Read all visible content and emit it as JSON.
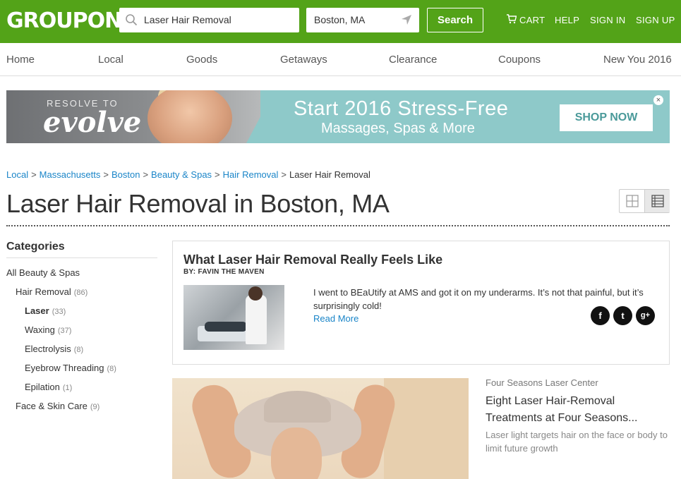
{
  "header": {
    "logo": "GROUPON",
    "search_value": "Laser Hair Removal",
    "location_value": "Boston, MA",
    "search_button": "Search",
    "cart": "CART",
    "help": "HELP",
    "sign_in": "SIGN IN",
    "sign_up": "SIGN UP",
    "brand_color": "#53a318"
  },
  "topnav": [
    "Home",
    "Local",
    "Goods",
    "Getaways",
    "Clearance",
    "Coupons",
    "New You 2016"
  ],
  "banner": {
    "resolve_to": "RESOLVE TO",
    "evolve": "evolve",
    "headline": "Start 2016 Stress-Free",
    "subline": "Massages, Spas & More",
    "cta": "SHOP NOW",
    "close": "×",
    "accent": "#8ec9c9"
  },
  "breadcrumb": {
    "links": [
      "Local",
      "Massachusetts",
      "Boston",
      "Beauty & Spas",
      "Hair Removal"
    ],
    "current": "Laser Hair Removal",
    "separator": ">"
  },
  "page_title": "Laser Hair Removal in Boston, MA",
  "sidebar": {
    "heading": "Categories",
    "items": [
      {
        "label": "All Beauty & Spas",
        "count": ""
      },
      {
        "label": "Hair Removal",
        "count": "(86)"
      },
      {
        "label": "Laser",
        "count": "(33)"
      },
      {
        "label": "Waxing",
        "count": "(37)"
      },
      {
        "label": "Electrolysis",
        "count": "(8)"
      },
      {
        "label": "Eyebrow Threading",
        "count": "(8)"
      },
      {
        "label": "Epilation",
        "count": "(1)"
      },
      {
        "label": "Face & Skin Care",
        "count": "(9)"
      }
    ]
  },
  "article": {
    "title": "What Laser Hair Removal Really Feels Like",
    "author": "BY: FAVIN THE MAVEN",
    "body": "I went to BEaUtify at AMS and got it on my underarms. It’s not that painful, but it’s surprisingly cold!",
    "read_more": "Read More",
    "social": {
      "facebook": "f",
      "twitter": "t",
      "google": "g+"
    }
  },
  "deal": {
    "merchant": "Four Seasons Laser Center",
    "title": "Eight Laser Hair-Removal Treatments at Four Seasons...",
    "description": "Laser light targets hair on the face or body to limit future growth"
  }
}
